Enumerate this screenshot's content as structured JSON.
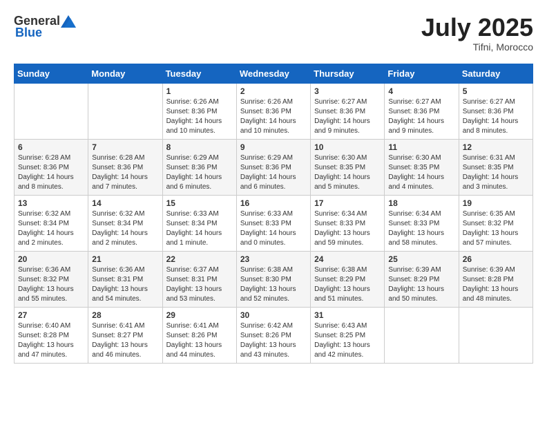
{
  "header": {
    "logo_general": "General",
    "logo_blue": "Blue",
    "month_year": "July 2025",
    "location": "Tifni, Morocco"
  },
  "calendar": {
    "days_of_week": [
      "Sunday",
      "Monday",
      "Tuesday",
      "Wednesday",
      "Thursday",
      "Friday",
      "Saturday"
    ],
    "weeks": [
      [
        {
          "day": "",
          "sunrise": "",
          "sunset": "",
          "daylight": ""
        },
        {
          "day": "",
          "sunrise": "",
          "sunset": "",
          "daylight": ""
        },
        {
          "day": "1",
          "sunrise": "Sunrise: 6:26 AM",
          "sunset": "Sunset: 8:36 PM",
          "daylight": "Daylight: 14 hours and 10 minutes."
        },
        {
          "day": "2",
          "sunrise": "Sunrise: 6:26 AM",
          "sunset": "Sunset: 8:36 PM",
          "daylight": "Daylight: 14 hours and 10 minutes."
        },
        {
          "day": "3",
          "sunrise": "Sunrise: 6:27 AM",
          "sunset": "Sunset: 8:36 PM",
          "daylight": "Daylight: 14 hours and 9 minutes."
        },
        {
          "day": "4",
          "sunrise": "Sunrise: 6:27 AM",
          "sunset": "Sunset: 8:36 PM",
          "daylight": "Daylight: 14 hours and 9 minutes."
        },
        {
          "day": "5",
          "sunrise": "Sunrise: 6:27 AM",
          "sunset": "Sunset: 8:36 PM",
          "daylight": "Daylight: 14 hours and 8 minutes."
        }
      ],
      [
        {
          "day": "6",
          "sunrise": "Sunrise: 6:28 AM",
          "sunset": "Sunset: 8:36 PM",
          "daylight": "Daylight: 14 hours and 8 minutes."
        },
        {
          "day": "7",
          "sunrise": "Sunrise: 6:28 AM",
          "sunset": "Sunset: 8:36 PM",
          "daylight": "Daylight: 14 hours and 7 minutes."
        },
        {
          "day": "8",
          "sunrise": "Sunrise: 6:29 AM",
          "sunset": "Sunset: 8:36 PM",
          "daylight": "Daylight: 14 hours and 6 minutes."
        },
        {
          "day": "9",
          "sunrise": "Sunrise: 6:29 AM",
          "sunset": "Sunset: 8:36 PM",
          "daylight": "Daylight: 14 hours and 6 minutes."
        },
        {
          "day": "10",
          "sunrise": "Sunrise: 6:30 AM",
          "sunset": "Sunset: 8:35 PM",
          "daylight": "Daylight: 14 hours and 5 minutes."
        },
        {
          "day": "11",
          "sunrise": "Sunrise: 6:30 AM",
          "sunset": "Sunset: 8:35 PM",
          "daylight": "Daylight: 14 hours and 4 minutes."
        },
        {
          "day": "12",
          "sunrise": "Sunrise: 6:31 AM",
          "sunset": "Sunset: 8:35 PM",
          "daylight": "Daylight: 14 hours and 3 minutes."
        }
      ],
      [
        {
          "day": "13",
          "sunrise": "Sunrise: 6:32 AM",
          "sunset": "Sunset: 8:34 PM",
          "daylight": "Daylight: 14 hours and 2 minutes."
        },
        {
          "day": "14",
          "sunrise": "Sunrise: 6:32 AM",
          "sunset": "Sunset: 8:34 PM",
          "daylight": "Daylight: 14 hours and 2 minutes."
        },
        {
          "day": "15",
          "sunrise": "Sunrise: 6:33 AM",
          "sunset": "Sunset: 8:34 PM",
          "daylight": "Daylight: 14 hours and 1 minute."
        },
        {
          "day": "16",
          "sunrise": "Sunrise: 6:33 AM",
          "sunset": "Sunset: 8:33 PM",
          "daylight": "Daylight: 14 hours and 0 minutes."
        },
        {
          "day": "17",
          "sunrise": "Sunrise: 6:34 AM",
          "sunset": "Sunset: 8:33 PM",
          "daylight": "Daylight: 13 hours and 59 minutes."
        },
        {
          "day": "18",
          "sunrise": "Sunrise: 6:34 AM",
          "sunset": "Sunset: 8:33 PM",
          "daylight": "Daylight: 13 hours and 58 minutes."
        },
        {
          "day": "19",
          "sunrise": "Sunrise: 6:35 AM",
          "sunset": "Sunset: 8:32 PM",
          "daylight": "Daylight: 13 hours and 57 minutes."
        }
      ],
      [
        {
          "day": "20",
          "sunrise": "Sunrise: 6:36 AM",
          "sunset": "Sunset: 8:32 PM",
          "daylight": "Daylight: 13 hours and 55 minutes."
        },
        {
          "day": "21",
          "sunrise": "Sunrise: 6:36 AM",
          "sunset": "Sunset: 8:31 PM",
          "daylight": "Daylight: 13 hours and 54 minutes."
        },
        {
          "day": "22",
          "sunrise": "Sunrise: 6:37 AM",
          "sunset": "Sunset: 8:31 PM",
          "daylight": "Daylight: 13 hours and 53 minutes."
        },
        {
          "day": "23",
          "sunrise": "Sunrise: 6:38 AM",
          "sunset": "Sunset: 8:30 PM",
          "daylight": "Daylight: 13 hours and 52 minutes."
        },
        {
          "day": "24",
          "sunrise": "Sunrise: 6:38 AM",
          "sunset": "Sunset: 8:29 PM",
          "daylight": "Daylight: 13 hours and 51 minutes."
        },
        {
          "day": "25",
          "sunrise": "Sunrise: 6:39 AM",
          "sunset": "Sunset: 8:29 PM",
          "daylight": "Daylight: 13 hours and 50 minutes."
        },
        {
          "day": "26",
          "sunrise": "Sunrise: 6:39 AM",
          "sunset": "Sunset: 8:28 PM",
          "daylight": "Daylight: 13 hours and 48 minutes."
        }
      ],
      [
        {
          "day": "27",
          "sunrise": "Sunrise: 6:40 AM",
          "sunset": "Sunset: 8:28 PM",
          "daylight": "Daylight: 13 hours and 47 minutes."
        },
        {
          "day": "28",
          "sunrise": "Sunrise: 6:41 AM",
          "sunset": "Sunset: 8:27 PM",
          "daylight": "Daylight: 13 hours and 46 minutes."
        },
        {
          "day": "29",
          "sunrise": "Sunrise: 6:41 AM",
          "sunset": "Sunset: 8:26 PM",
          "daylight": "Daylight: 13 hours and 44 minutes."
        },
        {
          "day": "30",
          "sunrise": "Sunrise: 6:42 AM",
          "sunset": "Sunset: 8:26 PM",
          "daylight": "Daylight: 13 hours and 43 minutes."
        },
        {
          "day": "31",
          "sunrise": "Sunrise: 6:43 AM",
          "sunset": "Sunset: 8:25 PM",
          "daylight": "Daylight: 13 hours and 42 minutes."
        },
        {
          "day": "",
          "sunrise": "",
          "sunset": "",
          "daylight": ""
        },
        {
          "day": "",
          "sunrise": "",
          "sunset": "",
          "daylight": ""
        }
      ]
    ]
  }
}
